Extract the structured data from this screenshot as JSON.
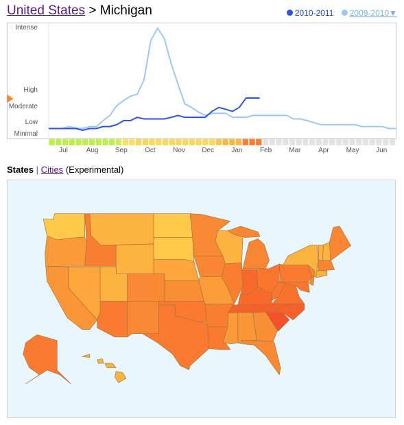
{
  "header": {
    "breadcrumb_link": "United States",
    "separator": ">",
    "current": "Michigan"
  },
  "legend": {
    "current_season": "2010-2011",
    "compare_season": "2009-2010",
    "compare_arrow": "▼",
    "current_color": "#2a52e8",
    "compare_color": "#9cc8f6"
  },
  "chart_data": {
    "type": "line",
    "y_levels": [
      "Minimal",
      "Low",
      "Moderate",
      "High",
      "Intense"
    ],
    "ylim": [
      0,
      4
    ],
    "x_tick_labels": [
      "Jul",
      "Aug",
      "Sep",
      "Oct",
      "Nov",
      "Dec",
      "Jan",
      "Feb",
      "Mar",
      "Apr",
      "May",
      "Jun"
    ],
    "current_level_marker": 2.5,
    "series": [
      {
        "name": "2009-2010",
        "color": "#9cc8f6",
        "values": [
          0.5,
          0.5,
          0.5,
          0.67,
          0.54,
          0.5,
          0.67,
          0.67,
          1.13,
          1.46,
          2.08,
          2.39,
          2.65,
          2.77,
          3.17,
          3.8,
          4.0,
          3.83,
          3.43,
          3.1,
          2.18,
          1.97,
          1.68,
          1.46,
          1.6,
          1.6,
          1.6,
          1.34,
          1.34,
          1.34,
          1.46,
          1.46,
          1.46,
          1.46,
          1.46,
          1.46,
          1.24,
          1.24,
          1.13,
          1.0,
          0.83,
          0.83,
          0.83,
          0.83,
          0.83,
          0.83,
          0.67,
          0.67,
          0.67,
          0.67,
          0.5,
          0.5
        ]
      },
      {
        "name": "2010-2011",
        "color": "#2a52e8",
        "values": [
          0.5,
          0.5,
          0.5,
          0.5,
          0.5,
          0.35,
          0.5,
          0.5,
          0.67,
          0.67,
          0.83,
          1.13,
          1.13,
          1.34,
          1.24,
          1.24,
          1.24,
          1.24,
          1.34,
          1.46,
          1.34,
          1.34,
          1.34,
          1.34,
          1.72,
          1.97,
          1.85,
          1.72,
          1.97,
          2.54,
          2.54,
          2.54
        ]
      }
    ],
    "week_colors": [
      "#bff04a",
      "#bff04a",
      "#bff04a",
      "#bff04a",
      "#bff04a",
      "#bff04a",
      "#bff04a",
      "#bff04a",
      "#bff04a",
      "#bff04a",
      "#d4ec5a",
      "#fde060",
      "#fde060",
      "#fdd857",
      "#fdd857",
      "#fdd857",
      "#fdd857",
      "#fdd857",
      "#fdd857",
      "#fdd857",
      "#fdd857",
      "#fdd857",
      "#fdd857",
      "#fdd857",
      "#fdd857",
      "#fdc448",
      "#fdb840",
      "#fdb840",
      "#fdb840",
      "#fb7e30",
      "#fb7e30",
      "#fb7e30",
      "#e3e3e3",
      "#e3e3e3",
      "#e3e3e3",
      "#e3e3e3",
      "#e3e3e3",
      "#e3e3e3",
      "#e3e3e3",
      "#e3e3e3",
      "#e3e3e3",
      "#e3e3e3",
      "#e3e3e3",
      "#e3e3e3",
      "#e3e3e3",
      "#e3e3e3",
      "#e3e3e3",
      "#e3e3e3",
      "#e3e3e3",
      "#e3e3e3",
      "#e3e3e3",
      "#e3e3e3"
    ],
    "marker_color": "#f7893a"
  },
  "tabs": {
    "states": "States",
    "divider": "|",
    "cities": "Cities",
    "note": "(Experimental)"
  },
  "map": {
    "background": "#e9f6fd",
    "state_colors": {
      "WA": "#ffc94a",
      "ND": "#ffc94a",
      "SD": "#ffc94a",
      "MT": "#fdb33f",
      "WY": "#fdb33f",
      "UT": "#fdb33f",
      "NY": "#fdb33f",
      "VT": "#fdb33f",
      "NH": "#fdb33f",
      "CT": "#fdb33f",
      "WI": "#fdb33f",
      "HI": "#fdb33f",
      "NV": "#fca63c",
      "OR": "#fb9a38",
      "CA": "#fb9638",
      "NE": "#fca63c",
      "MO": "#fb9c38",
      "MS": "#fb9a38",
      "AL": "#fb9638",
      "CO": "#f98a33",
      "NM": "#f98a33",
      "KS": "#f98f34",
      "MN": "#f98a33",
      "IA": "#f98633",
      "MI": "#f98633",
      "GA": "#f98f34",
      "FL": "#f98a33",
      "ME": "#f98633",
      "MA": "#f98633",
      "NJ": "#f98633",
      "ID": "#f97e30",
      "AZ": "#f97a30",
      "TX": "#f97a30",
      "OK": "#f97a30",
      "LA": "#f97a30",
      "AR": "#f97e30",
      "IL": "#f97e30",
      "OH": "#f97530",
      "PA": "#f97a30",
      "VA": "#f8722e",
      "WV": "#f97530",
      "MD": "#f97530",
      "AK": "#f97a30",
      "IN": "#f76a2c",
      "KY": "#f76a2c",
      "TN": "#f6602b",
      "NC": "#f6602b",
      "SC": "#f5502a"
    }
  }
}
